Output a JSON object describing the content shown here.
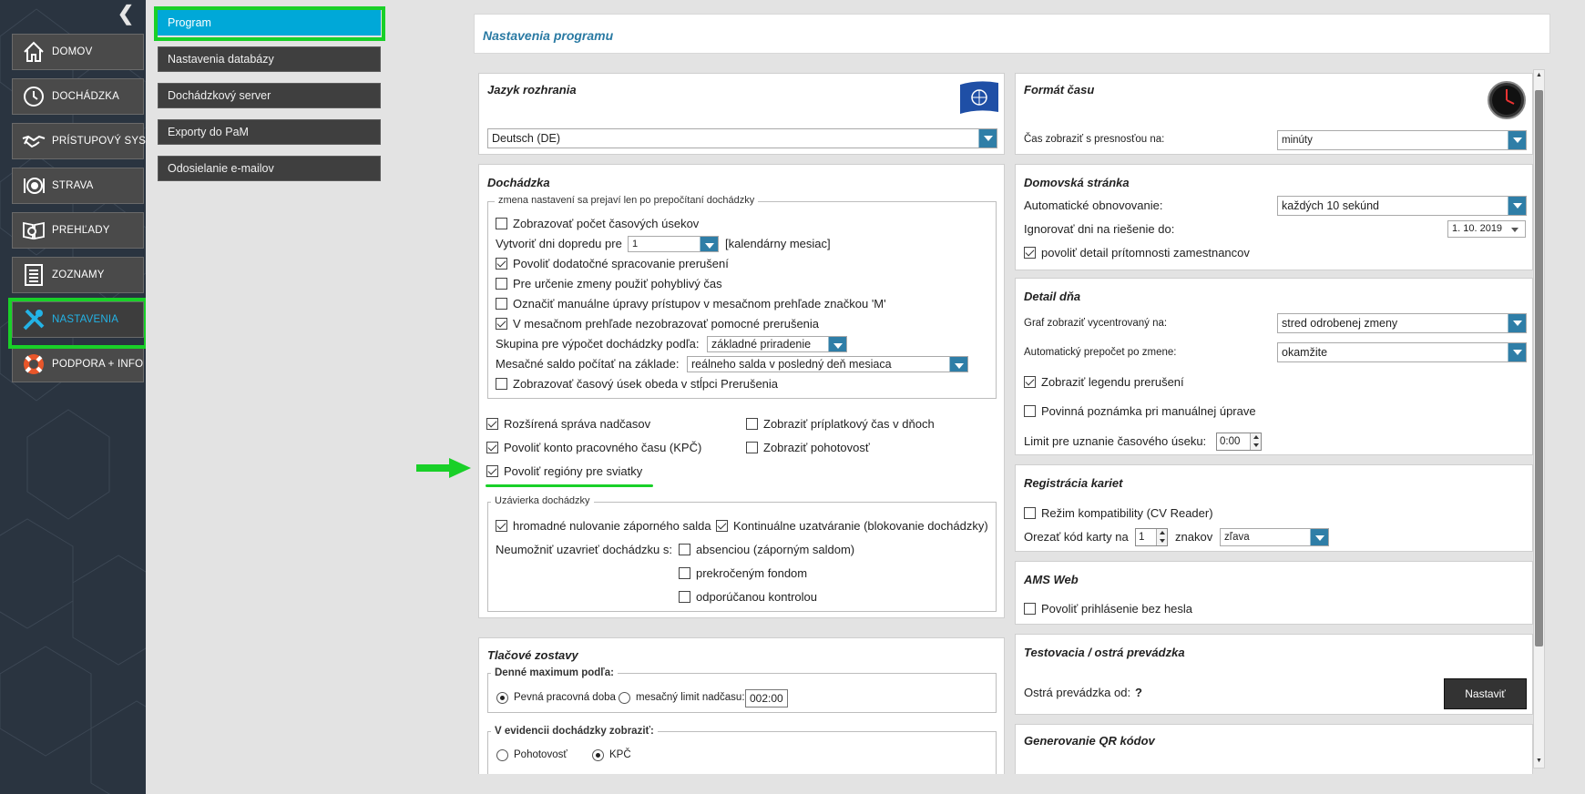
{
  "nav": {
    "items": [
      {
        "label": "DOMOV",
        "icon": "home-icon"
      },
      {
        "label": "DOCHÁDZKA",
        "icon": "clock-icon"
      },
      {
        "label": "PRÍSTUPOVÝ SYS.",
        "icon": "handshake-icon"
      },
      {
        "label": "STRAVA",
        "icon": "plate-icon"
      },
      {
        "label": "PREHĽADY",
        "icon": "book-search-icon"
      },
      {
        "label": "ZOZNAMY",
        "icon": "list-icon"
      },
      {
        "label": "NASTAVENIA",
        "icon": "tools-icon"
      },
      {
        "label": "PODPORA + INFO",
        "icon": "lifebuoy-icon"
      }
    ],
    "active": "NASTAVENIA"
  },
  "subnav": {
    "items": [
      "Program",
      "Nastavenia databázy",
      "Dochádzkový server",
      "Exporty do PaM",
      "Odosielanie e-mailov"
    ],
    "active": "Program"
  },
  "page_title": "Nastavenia programu",
  "jazyk": {
    "title": "Jazyk rozhrania",
    "value": "Deutsch (DE)",
    "icon": "un-flag-icon"
  },
  "format_casu": {
    "title": "Formát času",
    "label": "Čas zobraziť s presnosťou na:",
    "value": "minúty",
    "icon": "clock-icon"
  },
  "dochadzka": {
    "title": "Dochádzka",
    "legend": "zmena nastavení sa prejaví len po prepočítaní dochádzky",
    "opt1": {
      "label": "Zobrazovať počet časových úsekov",
      "checked": false
    },
    "vytvorit_label": "Vytvoriť dni dopredu pre",
    "vytvorit_value": "1",
    "vytvorit_unit": "[kalendárny mesiac]",
    "opt2": {
      "label": "Povoliť dodatočné spracovanie prerušení",
      "checked": true
    },
    "opt3": {
      "label": "Pre určenie zmeny použiť pohyblivý čas",
      "checked": false
    },
    "opt4": {
      "label": "Označiť manuálne úpravy prístupov v mesačnom prehľade značkou 'M'",
      "checked": false
    },
    "opt5": {
      "label": "V mesačnom prehľade nezobrazovať pomocné prerušenia",
      "checked": true
    },
    "skupina_label": "Skupina pre výpočet dochádzky podľa:",
    "skupina_value": "základné priradenie",
    "saldo_label": "Mesačné saldo počítať na základe:",
    "saldo_value": "reálneho salda v posledný deň mesiaca",
    "opt6": {
      "label": "Zobrazovať časový úsek obeda v stĺpci Prerušenia",
      "checked": false
    },
    "rozsirena": {
      "label": "Rozšírená správa nadčasov",
      "checked": true
    },
    "priplatkovy": {
      "label": "Zobraziť príplatkový čas v dňoch",
      "checked": false
    },
    "kpc": {
      "label": "Povoliť konto pracovného času (KPČ)",
      "checked": true
    },
    "pohotovost": {
      "label": "Zobraziť pohotovosť",
      "checked": false
    },
    "regiony": {
      "label": "Povoliť regióny pre sviatky",
      "checked": true
    },
    "uzavierka_legend": "Uzávierka dochádzky",
    "hromadne": {
      "label": "hromadné nulovanie záporného salda",
      "checked": true
    },
    "kontinualne": {
      "label": "Kontinuálne uzatváranie (blokovanie dochádzky)",
      "checked": true
    },
    "neumoznit_label": "Neumožniť uzavrieť dochádzku s:",
    "absenciou": {
      "label": "absenciou (záporným saldom)",
      "checked": false
    },
    "prekrocenym": {
      "label": "prekročeným fondom",
      "checked": false
    },
    "odporucanou": {
      "label": "odporúčanou kontrolou",
      "checked": false
    }
  },
  "tlacove": {
    "title": "Tlačové zostavy",
    "denne_legend": "Denné maximum podľa:",
    "pevna": {
      "label": "Pevná pracovná doba",
      "checked": true
    },
    "mesacny": {
      "label": "mesačný limit nadčasu:",
      "checked": false
    },
    "limit_value": "002:00",
    "evidencia_legend": "V evidencii dochádzky zobraziť:",
    "pohot": {
      "label": "Pohotovosť",
      "checked": false
    },
    "kpc": {
      "label": "KPČ",
      "checked": true
    }
  },
  "domovska": {
    "title": "Domovská stránka",
    "obnov_label": "Automatické obnovovanie:",
    "obnov_value": "každých 10 sekúnd",
    "ignor_label": "Ignorovať dni na riešenie do:",
    "ignor_value": "1. 10. 2019",
    "detail": {
      "label": "povoliť detail prítomnosti zamestnancov",
      "checked": true
    }
  },
  "detail_dna": {
    "title": "Detail dňa",
    "graf_label": "Graf zobraziť vycentrovaný na:",
    "graf_value": "stred odrobenej zmeny",
    "prepocet_label": "Automatický prepočet po zmene:",
    "prepocet_value": "okamžite",
    "legenda": {
      "label": "Zobraziť legendu prerušení",
      "checked": true
    },
    "poznamka": {
      "label": "Povinná poznámka pri manuálnej úprave",
      "checked": false
    },
    "limit_label": "Limit pre uznanie časového úseku:",
    "limit_value": "0:00"
  },
  "registracia": {
    "title": "Registrácia kariet",
    "rezim": {
      "label": "Režim kompatibility (CV Reader)",
      "checked": false
    },
    "orezat_label": "Orezať kód karty na",
    "orezat_value": "1",
    "znakov_label": "znakov",
    "smer_value": "zľava"
  },
  "ams": {
    "title": "AMS Web",
    "povolit": {
      "label": "Povoliť prihlásenie bez hesla",
      "checked": false
    }
  },
  "testovacia": {
    "title": "Testovacia / ostrá prevádzka",
    "ostra_label": "Ostrá prevádzka od:",
    "ostra_value": "?",
    "button": "Nastaviť"
  },
  "qr": {
    "title": "Generovanie QR kódov"
  },
  "annotation": {
    "arrow_color": "#19d028",
    "highlight_color": "#19d028"
  }
}
